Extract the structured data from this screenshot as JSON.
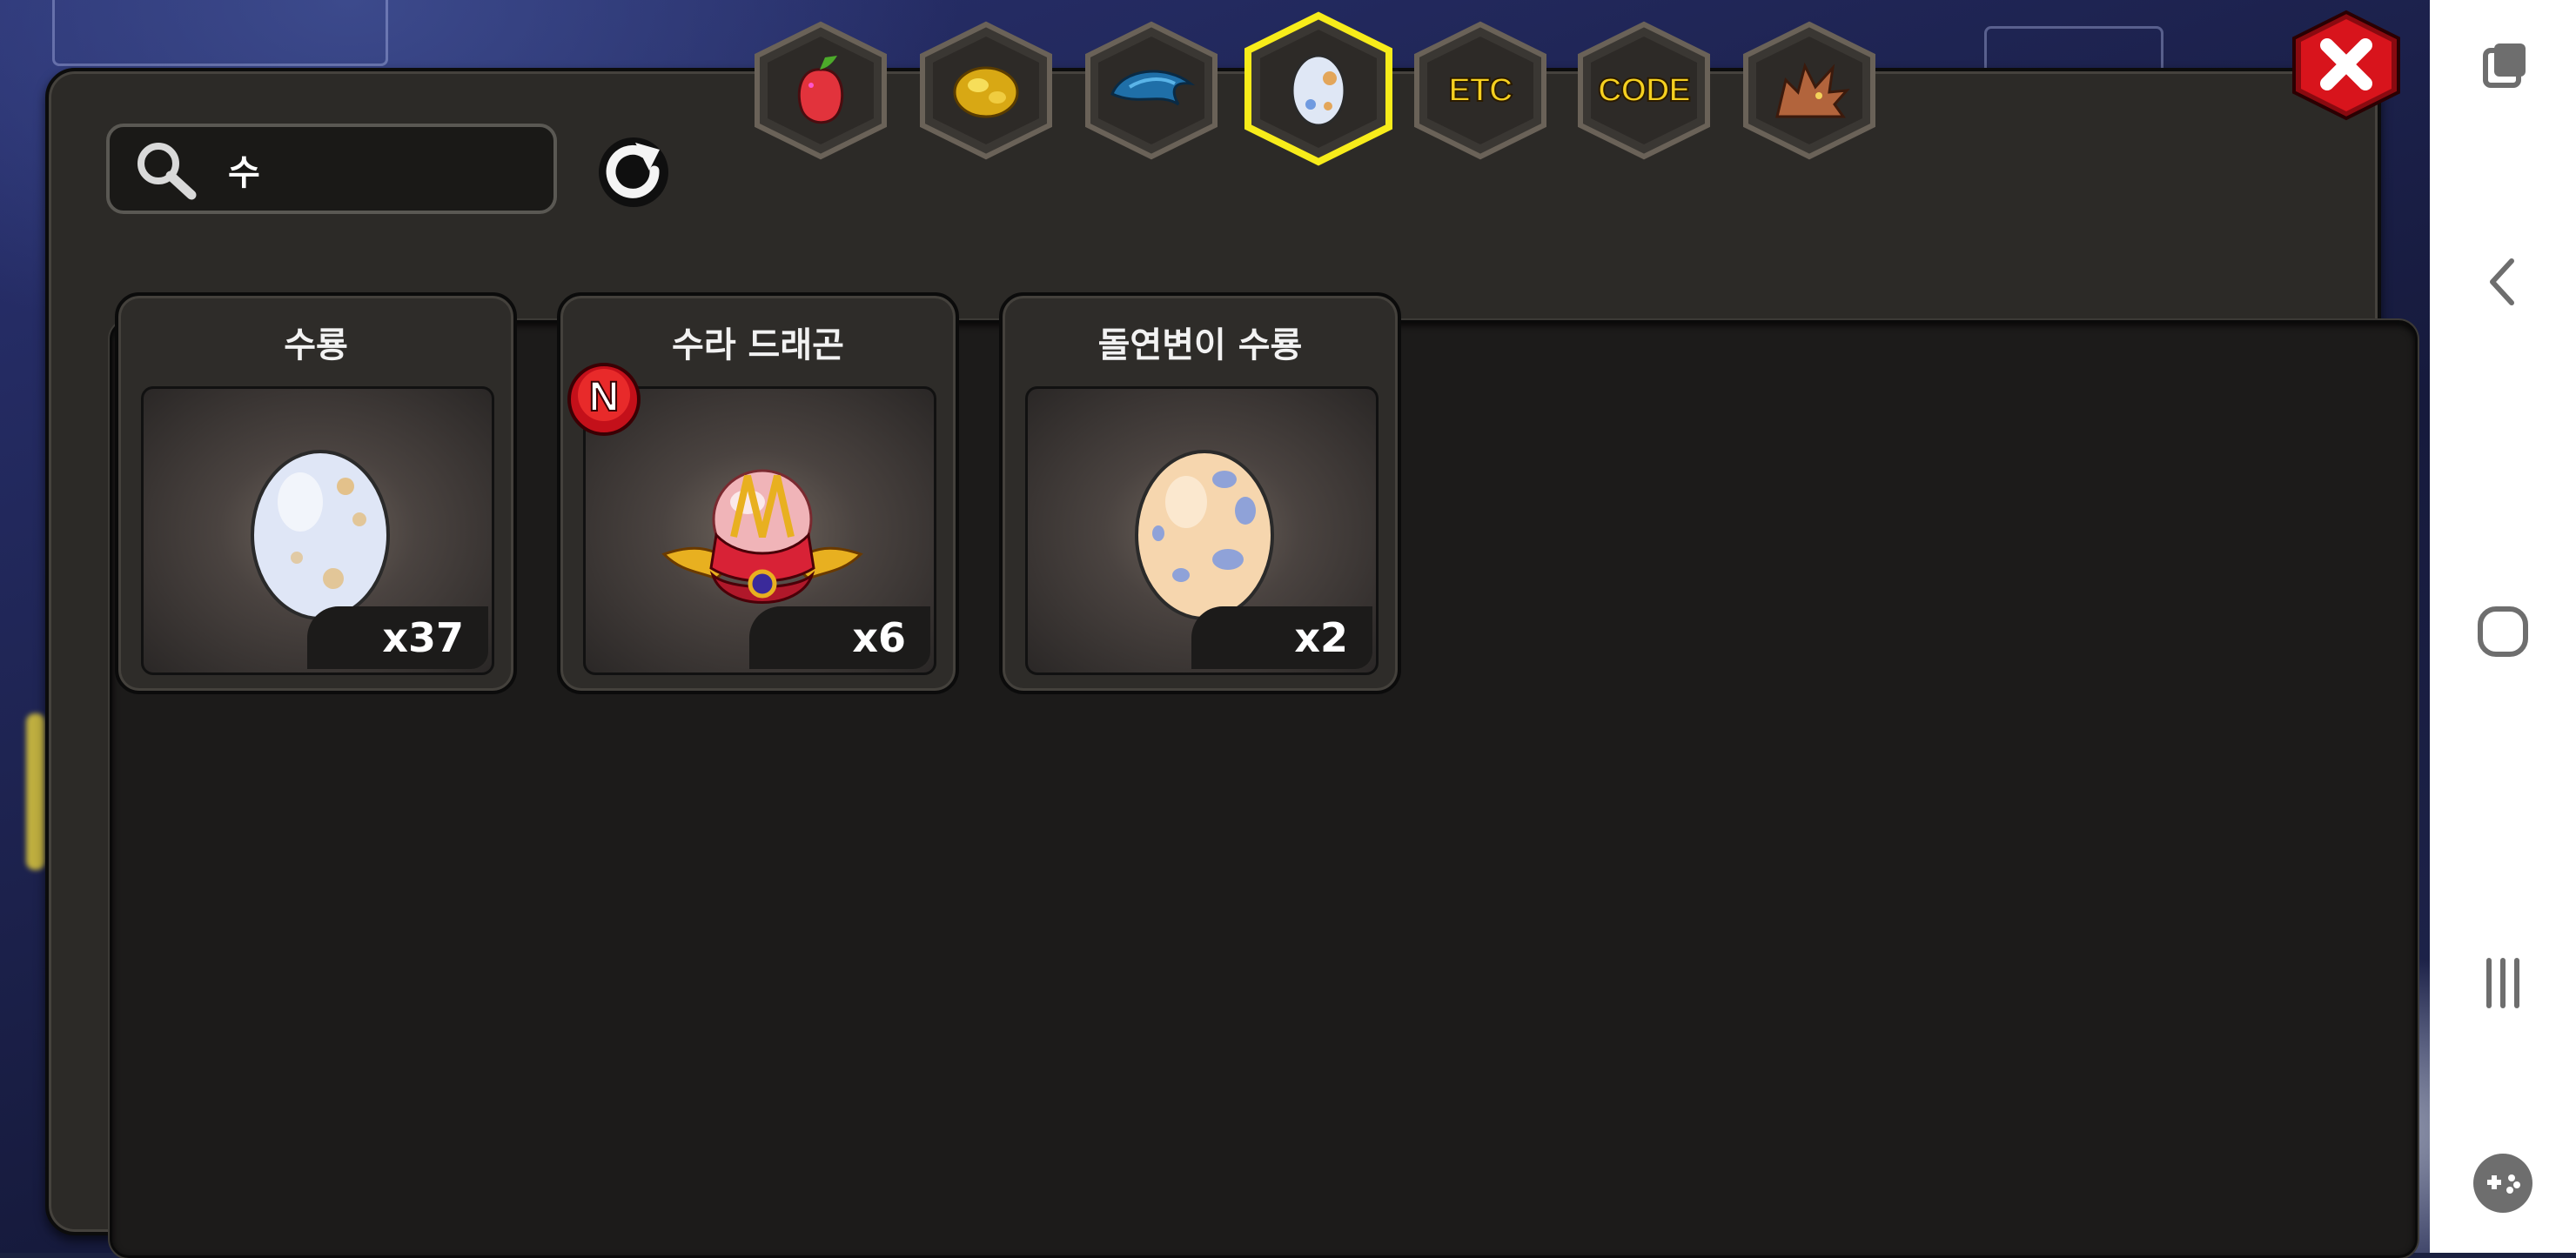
{
  "search": {
    "value": "수"
  },
  "tabs": [
    {
      "name": "fruit-tab",
      "label": "",
      "icon": "fruit-icon",
      "selected": false
    },
    {
      "name": "gold-tab",
      "label": "",
      "icon": "gold-icon",
      "selected": false
    },
    {
      "name": "scale-tab",
      "label": "",
      "icon": "blue-scale-icon",
      "selected": false
    },
    {
      "name": "egg-tab",
      "label": "",
      "icon": "egg-icon",
      "selected": true
    },
    {
      "name": "etc-tab",
      "label": "ETC",
      "icon": "",
      "selected": false
    },
    {
      "name": "code-tab",
      "label": "CODE",
      "icon": "",
      "selected": false
    },
    {
      "name": "dragon-tab",
      "label": "",
      "icon": "dragon-head-icon",
      "selected": false
    }
  ],
  "items": [
    {
      "name": "수룡",
      "quantity": "x37",
      "icon": "white-egg-icon",
      "is_new": false
    },
    {
      "name": "수라 드래곤",
      "quantity": "x6",
      "icon": "crest-orb-icon",
      "is_new": true
    },
    {
      "name": "돌연변이 수룡",
      "quantity": "x2",
      "icon": "orange-egg-icon",
      "is_new": false
    }
  ],
  "new_badge": "N",
  "colors": {
    "tab_selected_outline": "#f7ec1a",
    "close_red": "#d8141c",
    "panel_bg": "#2c2a27",
    "list_bg": "#1c1b1a"
  },
  "system_nav": [
    "recent-apps-icon",
    "back-icon",
    "home-icon",
    "menu-icon",
    "game-tools-icon"
  ]
}
